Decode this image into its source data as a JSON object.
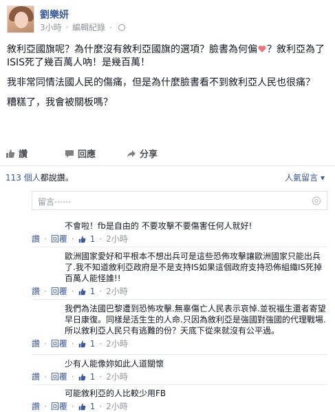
{
  "post": {
    "author": "劉樂妍",
    "time": "3小時",
    "edit_history": "編輯紀錄",
    "paragraphs": {
      "p1_a": "敘利亞國旗呢？為什麼沒有敘利亞國旗的選項？臉書為何偏",
      "p1_b": "？敘利亞為了ISIS死了幾百萬人吶！是幾百萬！",
      "p2": "我非常同情法國人民的傷痛，但是為什麼臉書看不到敘利亞人民也很痛？",
      "p3": "糟糕了，我會被關板嗎？"
    }
  },
  "actions": {
    "like": "讚",
    "comment": "回應",
    "share": "分享"
  },
  "likes": {
    "count": "113 個人",
    "suffix": "都說讚。",
    "sort": "人氣留言"
  },
  "comment_box": {
    "placeholder": "留言⋯⋯"
  },
  "comments": [
    {
      "text": "不會啦！fb是自由的 不要攻擊不要傷害任何人就好!",
      "like": "讚",
      "reply": "回覆",
      "likes": "1",
      "time": "2小時"
    },
    {
      "text": "歐洲國家愛好和平根本不想出兵可是這些恐佈攻擊讓歐洲國家只能出兵了.我不知道敘利亞政府是不是支持IS如果這個政府支持恐佈組織IS死掉百萬人能怪誰!!",
      "like": "讚",
      "reply": "回覆",
      "likes": "1",
      "time": "2小時"
    },
    {
      "text": "我們為法國巴黎遭到恐怖攻擊.無辜傷亡人民表示哀悼.並祝福生還者寄望早日康復。同樣是活生生的人命.只因為敘利亞是強國對強國的代理戰場.所以敘利亞人民只有逃難的份？天底下從來就沒有公平過。",
      "like": "讚",
      "reply": "回覆",
      "likes": "1",
      "time": "2小時"
    },
    {
      "text": "少有人能像妳如此人道關懷",
      "like": "讚",
      "reply": "回覆",
      "likes": "1",
      "time": "2小時"
    },
    {
      "text": "可能敘利亞的人比較少用FB",
      "like": "讚",
      "reply": "回覆",
      "likes": "1",
      "time": "2小時"
    }
  ],
  "colors": {
    "link": "#3b5998",
    "text": "#141823",
    "muted": "#90949c",
    "heart": "#e9757f"
  }
}
